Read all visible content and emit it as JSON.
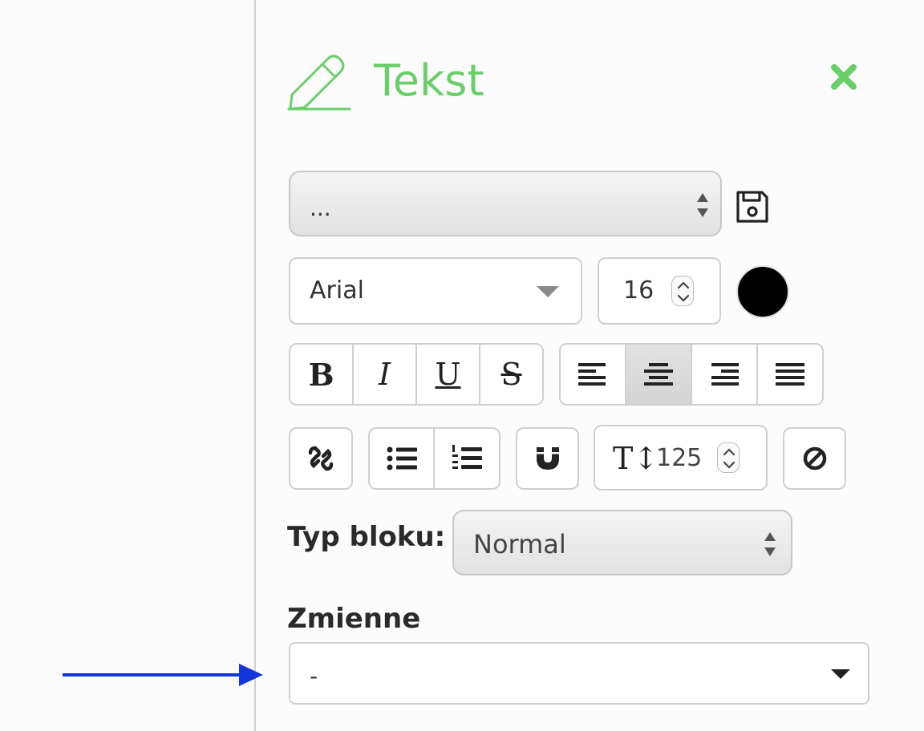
{
  "panel": {
    "title": "Tekst",
    "icons": {
      "header": "pencil-icon",
      "close": "close-x-icon",
      "save": "floppy-disk-icon"
    },
    "accent_color": "#6ccd6c"
  },
  "toolbar": {
    "preset_select_value": "...",
    "font_family_value": "Arial",
    "font_size_value": "16",
    "text_color": "#000000",
    "format_buttons": [
      {
        "label": "B",
        "name": "bold"
      },
      {
        "label": "I",
        "name": "italic"
      },
      {
        "label": "U",
        "name": "underline"
      },
      {
        "label": "S",
        "name": "strikethrough"
      }
    ],
    "align_buttons": [
      "align-left",
      "align-center",
      "align-right",
      "align-justify"
    ],
    "active_align": "align-center",
    "line_height_icon": "T↕",
    "line_height_value": "125"
  },
  "block_type": {
    "label": "Typ bloku:",
    "value": "Normal"
  },
  "variables": {
    "label": "Zmienne",
    "value": "-"
  },
  "annotation": {
    "arrow_color": "#1436d6"
  }
}
